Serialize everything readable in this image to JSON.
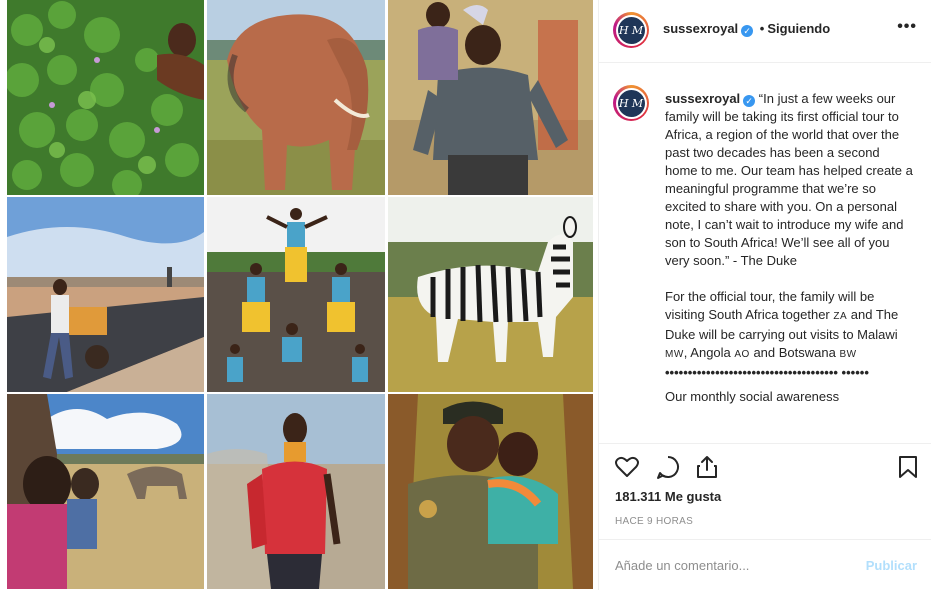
{
  "post": {
    "username": "sussexroyal",
    "verified_mark": "✓",
    "follow_state": "Siguiendo",
    "separator": "•",
    "more_label": "•••",
    "avatar_monogram": "H M"
  },
  "caption": {
    "username": "sussexroyal",
    "paragraph1": "“In just a few weeks our family will be taking its first official tour to Africa, a region of the world that over the past two decades has been a second home to me. Our team has helped create a meaningful programme that we’re so excited to share with you. On a personal note, I can’t wait to introduce my wife and son to South Africa! We’ll see all of you very soon.” - The Duke",
    "paragraph2_parts": {
      "a": "For the official tour, the family will be visiting South Africa together ",
      "za": "ZA",
      "b": " and The Duke will be carrying out visits to Malawi ",
      "mw": "MW",
      "c": ", Angola ",
      "ao": "AO",
      "d": " and Botswana ",
      "bw": "BW"
    },
    "dots_line": "•••••••••••••••••••••••••••••••••••••• ••••••",
    "cut_line": "Our monthly social awareness"
  },
  "actions": {
    "like_icon": "heart-icon",
    "comment_icon": "comment-icon",
    "share_icon": "share-icon",
    "save_icon": "bookmark-icon",
    "likes_text": "181.311 Me gusta",
    "timestamp": "HACE 9 HORAS"
  },
  "comment": {
    "placeholder": "Añade un comentario...",
    "publish_label": "Publicar"
  },
  "colors": {
    "accent_blue": "#3897f0",
    "publish_disabled": "#b2dffc",
    "muted": "#8e8e8e",
    "text": "#262626"
  },
  "photos": [
    {
      "name": "photo-man-in-water-hyacinth"
    },
    {
      "name": "photo-elephant"
    },
    {
      "name": "photo-smiling-boy"
    },
    {
      "name": "photo-man-pushing-cart"
    },
    {
      "name": "photo-acrobats-pyramid"
    },
    {
      "name": "photo-zebra"
    },
    {
      "name": "photo-elephant-savanna"
    },
    {
      "name": "photo-woman-beaded-necklace"
    },
    {
      "name": "photo-ranger-holding-child"
    }
  ]
}
